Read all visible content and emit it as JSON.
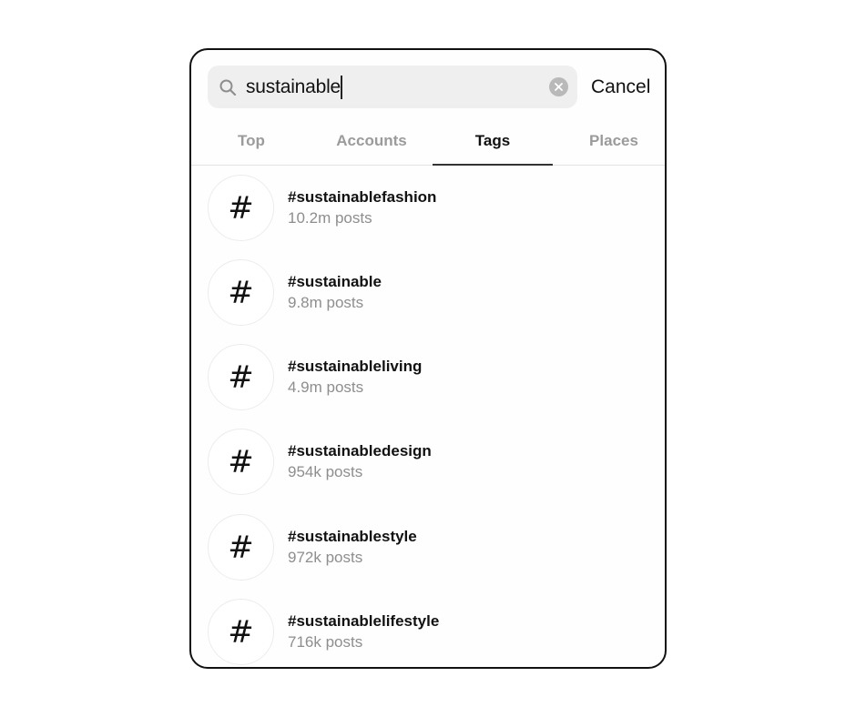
{
  "search": {
    "query": "sustainable",
    "clear_icon": "clear-circle-icon",
    "search_icon": "search-icon",
    "cancel_label": "Cancel"
  },
  "tabs": [
    {
      "label": "Top",
      "active": false
    },
    {
      "label": "Accounts",
      "active": false
    },
    {
      "label": "Tags",
      "active": true
    },
    {
      "label": "Places",
      "active": false
    }
  ],
  "results": [
    {
      "icon": "#",
      "name": "#sustainablefashion",
      "count": "10.2m posts"
    },
    {
      "icon": "#",
      "name": "#sustainable",
      "count": "9.8m posts"
    },
    {
      "icon": "#",
      "name": "#sustainableliving",
      "count": "4.9m posts"
    },
    {
      "icon": "#",
      "name": "#sustainabledesign",
      "count": "954k posts"
    },
    {
      "icon": "#",
      "name": "#sustainablestyle",
      "count": "972k posts"
    },
    {
      "icon": "#",
      "name": "#sustainablelifestyle",
      "count": "716k posts"
    }
  ]
}
